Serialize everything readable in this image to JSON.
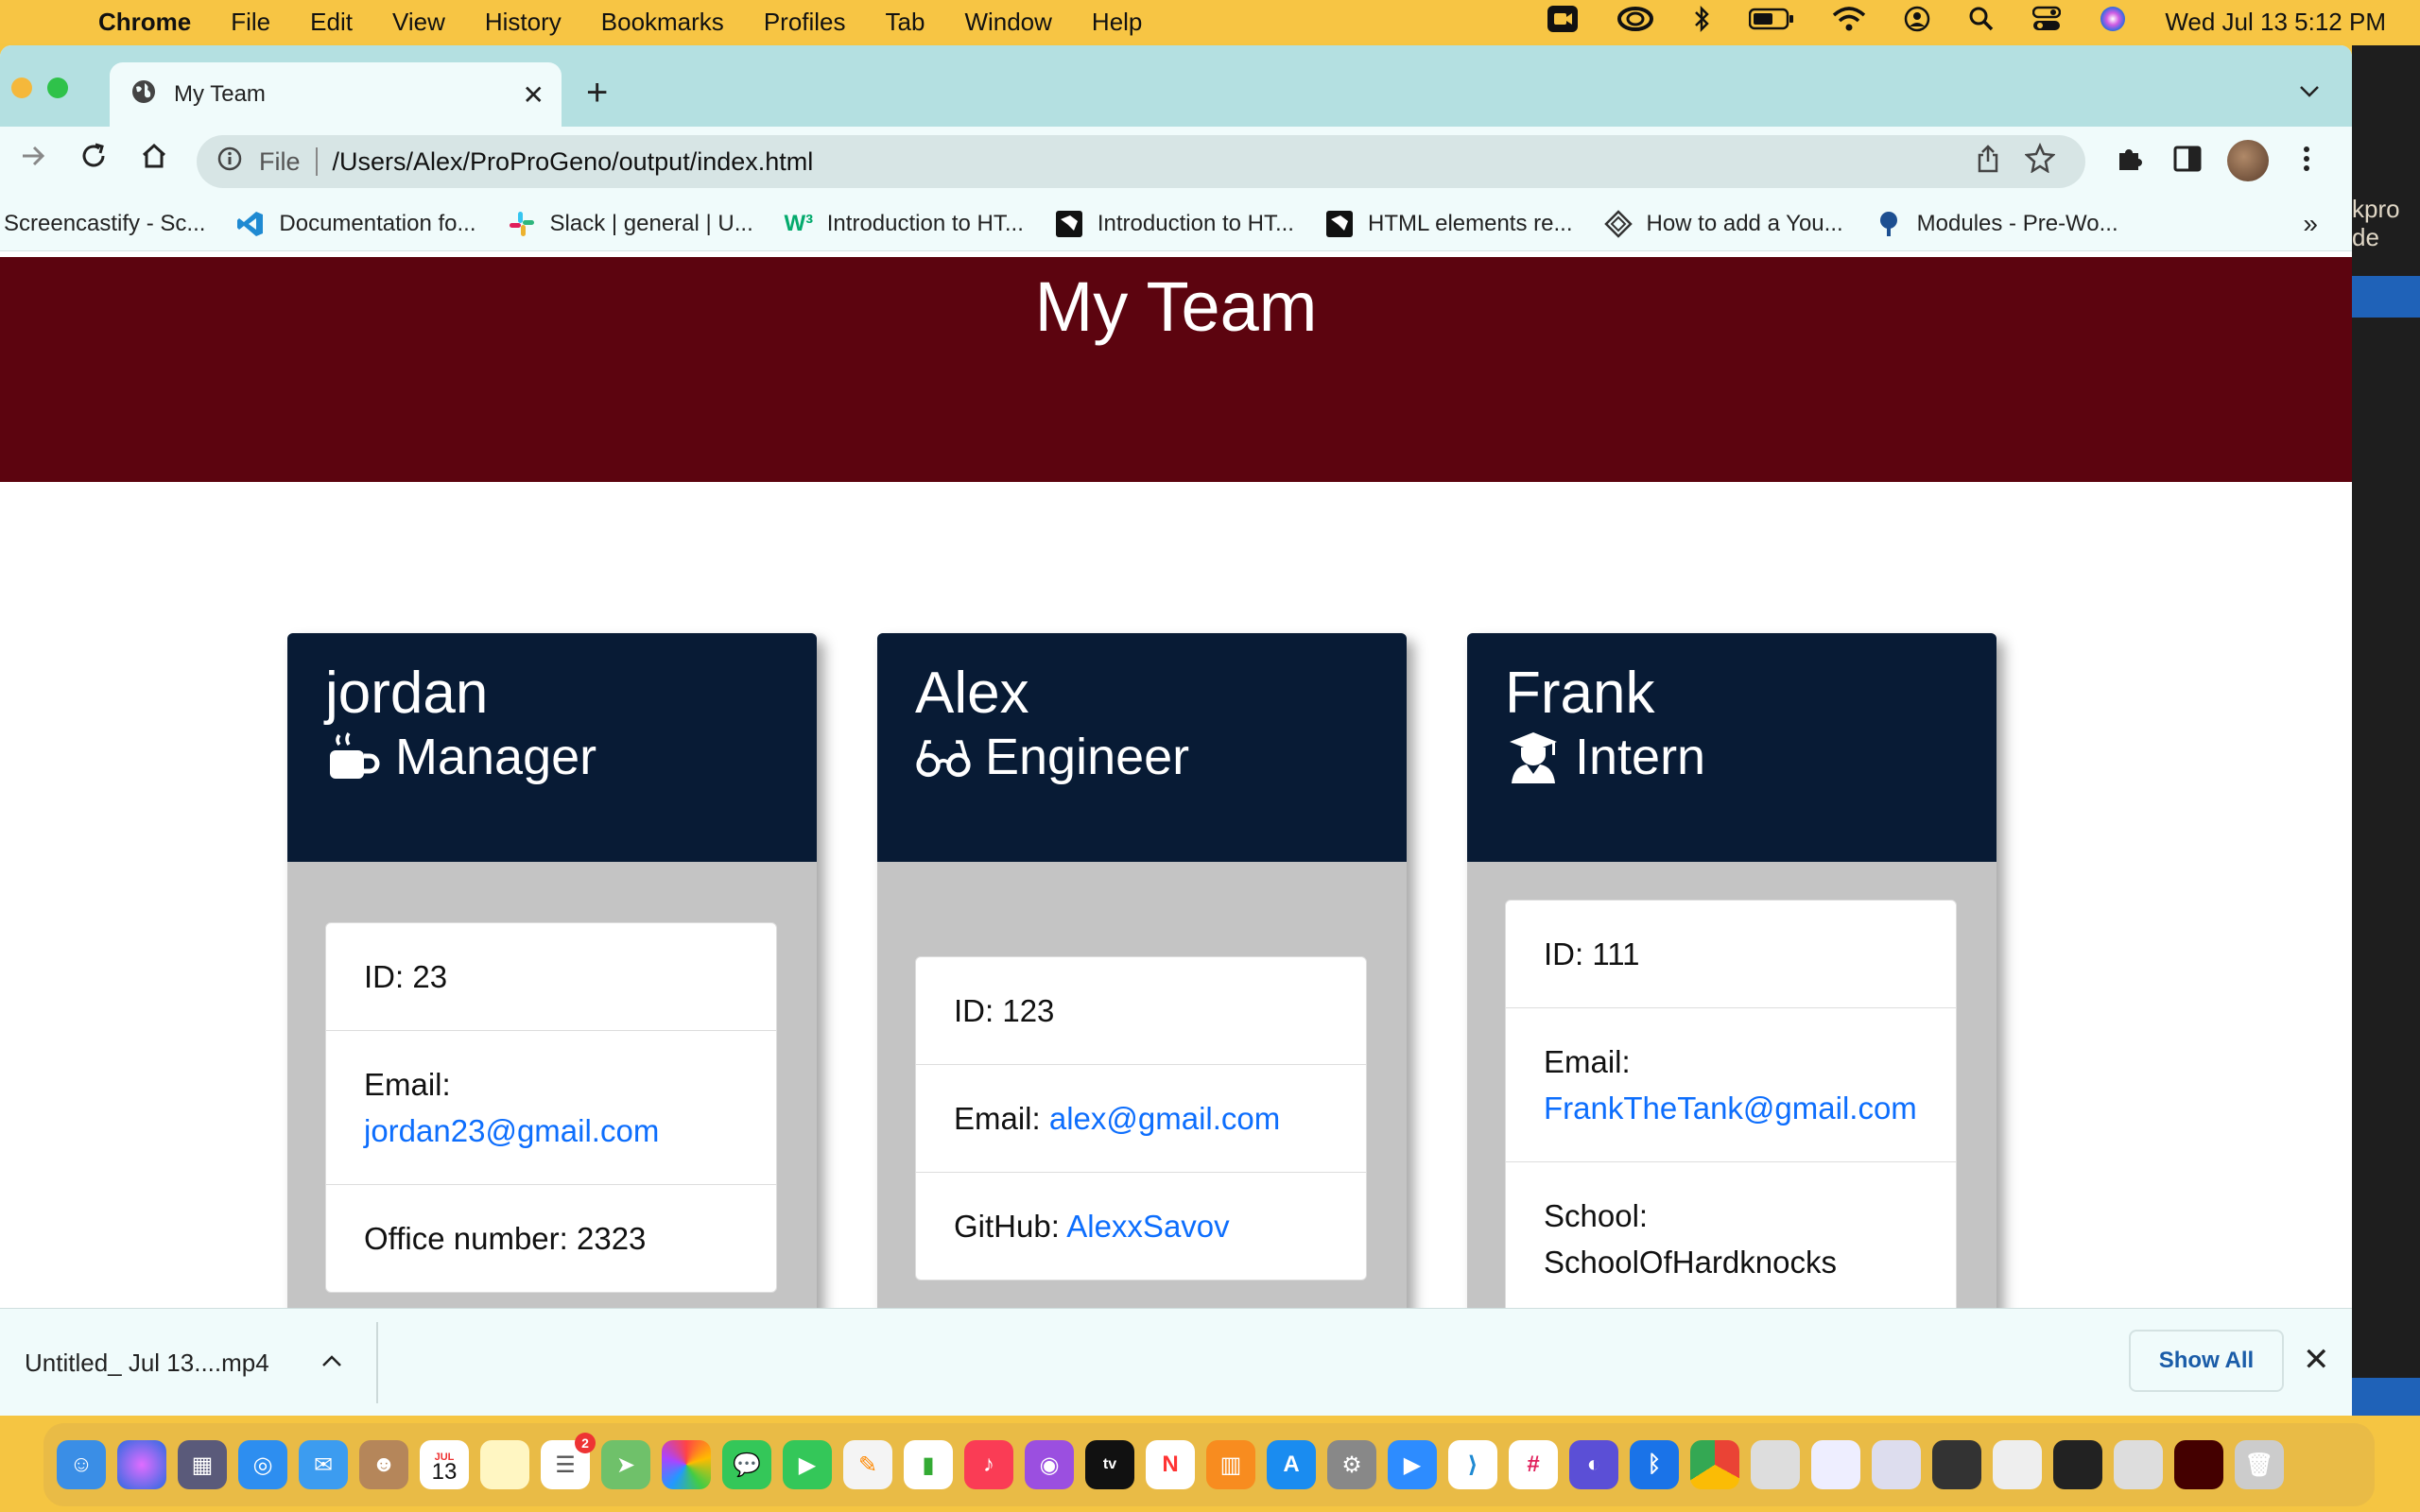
{
  "menubar": {
    "app": "Chrome",
    "items": [
      "File",
      "Edit",
      "View",
      "History",
      "Bookmarks",
      "Profiles",
      "Tab",
      "Window",
      "Help"
    ],
    "datetime": "Wed Jul 13  5:12 PM"
  },
  "browser": {
    "tab_title": "My Team",
    "new_tab_label": "+",
    "address_scheme": "File",
    "address_url": "/Users/Alex/ProProGeno/output/index.html",
    "bookmarks": [
      "Screencastify - Sc...",
      "Documentation fo...",
      "Slack | general | U...",
      "Introduction to HT...",
      "Introduction to HT...",
      "HTML elements re...",
      "How to add a You...",
      "Modules - Pre-Wo..."
    ],
    "bookmarks_more": "»"
  },
  "page": {
    "heading": "My Team",
    "cards": [
      {
        "name": "jordan",
        "role": "Manager",
        "role_icon": "mug-icon",
        "id_text": "ID: 23",
        "email_label": "Email:",
        "email": "jordan23@gmail.com",
        "extra_text": "Office number: 2323"
      },
      {
        "name": "Alex",
        "role": "Engineer",
        "role_icon": "glasses-icon",
        "id_text": "ID: 123",
        "email_label": "Email:",
        "email": "alex@gmail.com",
        "extra_label": "GitHub:",
        "extra_link": "AlexxSavov"
      },
      {
        "name": "Frank",
        "role": "Intern",
        "role_icon": "graduate-icon",
        "id_text": "ID: 111",
        "email_label": "Email:",
        "email": "FrankTheTank@gmail.com",
        "extra_label": "School:",
        "extra_value": "SchoolOfHardknocks"
      }
    ]
  },
  "download_bar": {
    "file_name": "Untitled_ Jul 13....mp4",
    "show_all": "Show All"
  },
  "side_app": {
    "text_line1": "kpro",
    "text_line2": "de"
  },
  "dock": {
    "calendar_month": "JUL",
    "calendar_day": "13",
    "reminders_badge": "2"
  },
  "colors": {
    "header_bg": "#5c040f",
    "card_header_bg": "#081b35",
    "card_body_bg": "#c4c4c4",
    "link": "#0d6efd",
    "chrome_tabstrip": "#b4e0e1",
    "menubar": "#f7c544"
  }
}
